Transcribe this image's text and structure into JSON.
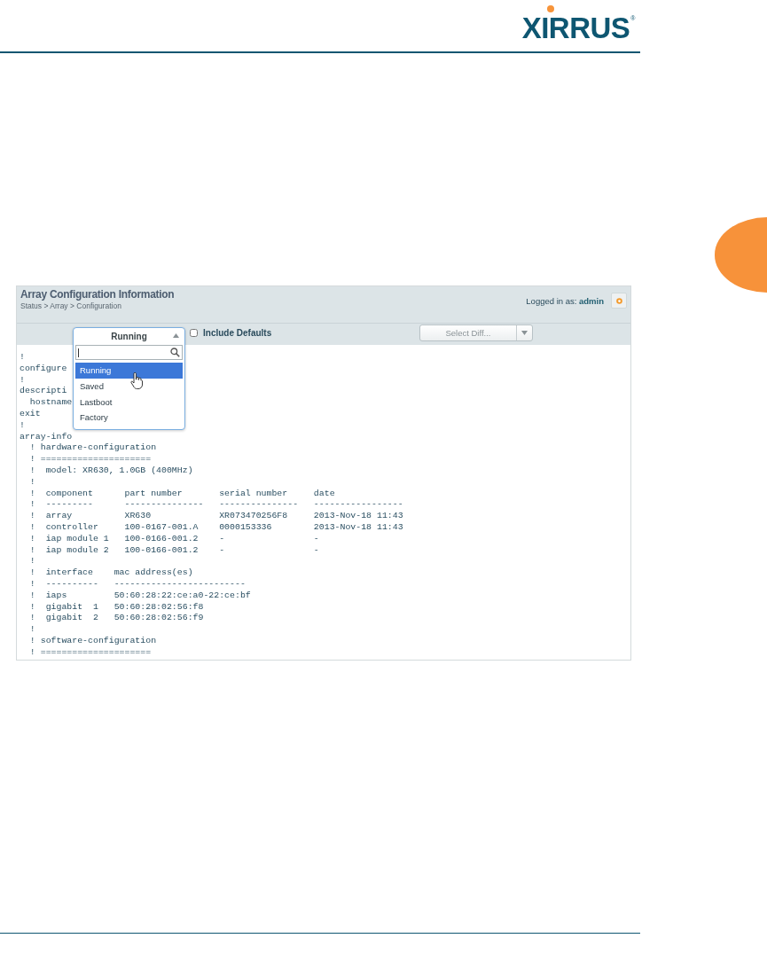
{
  "logo": {
    "text": "XIRRUS",
    "mark": "®"
  },
  "header": {
    "title": "Array Configuration Information",
    "breadcrumb": "Status > Array > Configuration",
    "login_label": "Logged in as:",
    "user": "admin"
  },
  "toolbar": {
    "config_select": {
      "value": "Running",
      "options": [
        {
          "label": "Running",
          "selected": true
        },
        {
          "label": "Saved",
          "selected": false
        },
        {
          "label": "Lastboot",
          "selected": false
        },
        {
          "label": "Factory",
          "selected": false
        }
      ]
    },
    "include_defaults": {
      "label": "Include Defaults",
      "checked": false
    },
    "diff_select": {
      "placeholder": "Select Diff..."
    }
  },
  "config_lines": [
    "!",
    "configure",
    "!",
    "descripti",
    "  hostname",
    "exit",
    "!",
    "array-info",
    "  ! hardware-configuration",
    "  ! =====================",
    "  !  model: XR630, 1.0GB (400MHz)",
    "  !",
    "  !  component      part number       serial number     date",
    "  !  ---------      ---------------   ---------------   -----------------",
    "  !  array          XR630             XR073470256F8     2013-Nov-18 11:43",
    "  !  controller     100-0167-001.A    0000153336        2013-Nov-18 11:43",
    "  !  iap module 1   100-0166-001.2    -                 -",
    "  !  iap module 2   100-0166-001.2    -                 -",
    "  !",
    "  !  interface    mac address(es)",
    "  !  ----------   -------------------------",
    "  !  iaps         50:60:28:22:ce:a0-22:ce:bf",
    "  !  gigabit  1   50:60:28:02:56:f8",
    "  !  gigabit  2   50:60:28:02:56:f9",
    "  !",
    "  ! software-configuration",
    "  ! ====================="
  ]
}
